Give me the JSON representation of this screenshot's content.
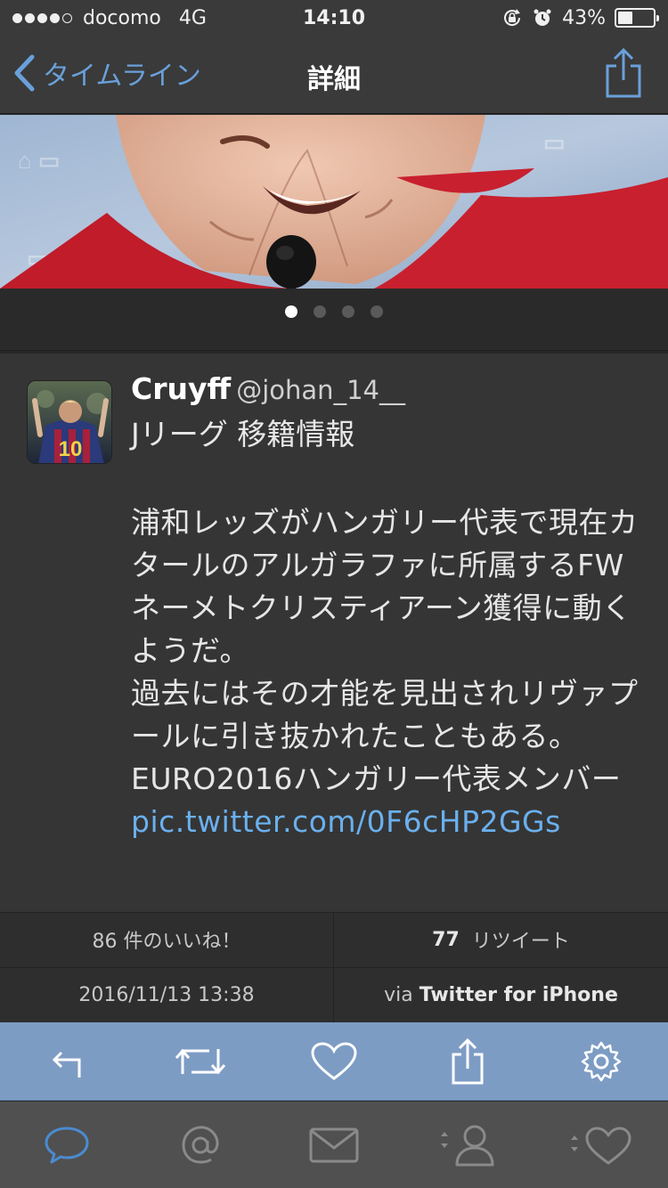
{
  "status_bar": {
    "carrier": "docomo",
    "network": "4G",
    "time": "14:10",
    "battery": "43%",
    "battery_level": 0.43,
    "signal_bars_filled": 4,
    "signal_bars_total": 5
  },
  "nav": {
    "back_label": "タイムライン",
    "title": "詳細",
    "accent_color": "#6aa0da"
  },
  "media": {
    "page_count": 4,
    "active_page": 1
  },
  "tweet": {
    "display_name": "Cruyff",
    "handle": "@johan_14__",
    "bio": "Jリーグ 移籍情報",
    "paragraphs": [
      "浦和レッズがハンガリー代表で現在カタールのアルガラファに所属するFWネーメトクリスティアーン獲得に動くようだ。",
      "過去にはその才能を見出されリヴァプールに引き抜かれたこともある。",
      "EURO2016ハンガリー代表メンバー"
    ],
    "link": "pic.twitter.com/0F6cHP2GGs",
    "avatar_jersey_number": "10",
    "link_color": "#6ab0ee"
  },
  "stats": {
    "likes_label": "86 件のいいね！",
    "retweet_count": "77",
    "retweet_label": "リツイート",
    "timestamp": "2016/11/13 13:38",
    "via_prefix": "via",
    "client": "Twitter for iPhone"
  },
  "action_bar": {
    "color": "#7d9cc4",
    "icons": [
      "reply-icon",
      "retweet-icon",
      "like-icon",
      "share-icon",
      "settings-icon"
    ]
  },
  "tab_bar": {
    "icons": [
      "timeline-bubble-icon",
      "mentions-at-icon",
      "messages-envelope-icon",
      "profile-icon",
      "favorites-heart-icon"
    ],
    "active_color": "#4a8bd0"
  }
}
